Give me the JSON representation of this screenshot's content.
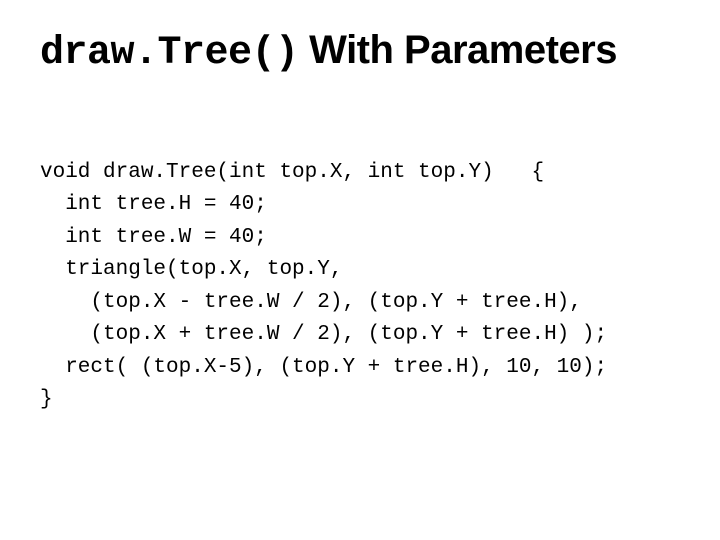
{
  "title": {
    "mono": "draw.Tree()",
    "rest": " With Parameters"
  },
  "code": {
    "l1": "void draw.Tree(int top.X, int top.Y)   {",
    "l2": "  int tree.H = 40;",
    "l3": "  int tree.W = 40;",
    "l4": "  triangle(top.X, top.Y,",
    "l5": "    (top.X - tree.W / 2), (top.Y + tree.H),",
    "l6": "    (top.X + tree.W / 2), (top.Y + tree.H) );",
    "l7": "  rect( (top.X-5), (top.Y + tree.H), 10, 10);",
    "l8": "}"
  }
}
